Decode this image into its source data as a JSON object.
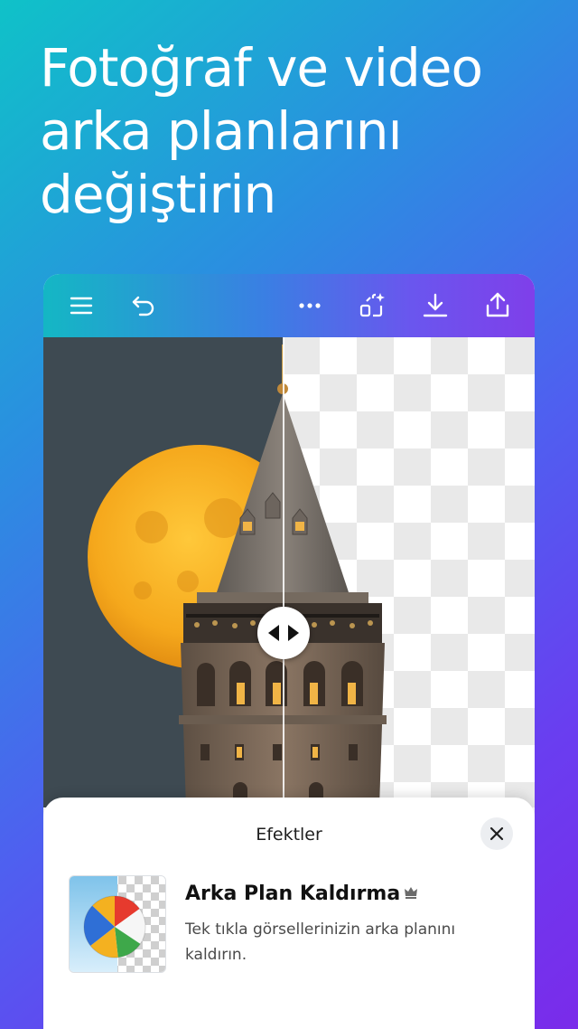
{
  "headline": {
    "line1": "Fotoğraf ve video",
    "line2": "arka planlarını",
    "line3": "değiştirin"
  },
  "toolbar": {
    "icons": [
      "menu-icon",
      "undo-icon",
      "more-icon",
      "magic-edit-icon",
      "download-icon",
      "share-icon"
    ]
  },
  "sheet": {
    "title": "Efektler",
    "effect": {
      "title": "Arka Plan Kaldırma",
      "description": "Tek tıkla görsellerinizin arka planını kaldırın.",
      "badge_icon": "crown-icon"
    }
  },
  "colors": {
    "toolbar_start": "#14b7c4",
    "toolbar_end": "#7f3fea",
    "moon": "#f5a81c",
    "sky": "#3e4a52"
  }
}
